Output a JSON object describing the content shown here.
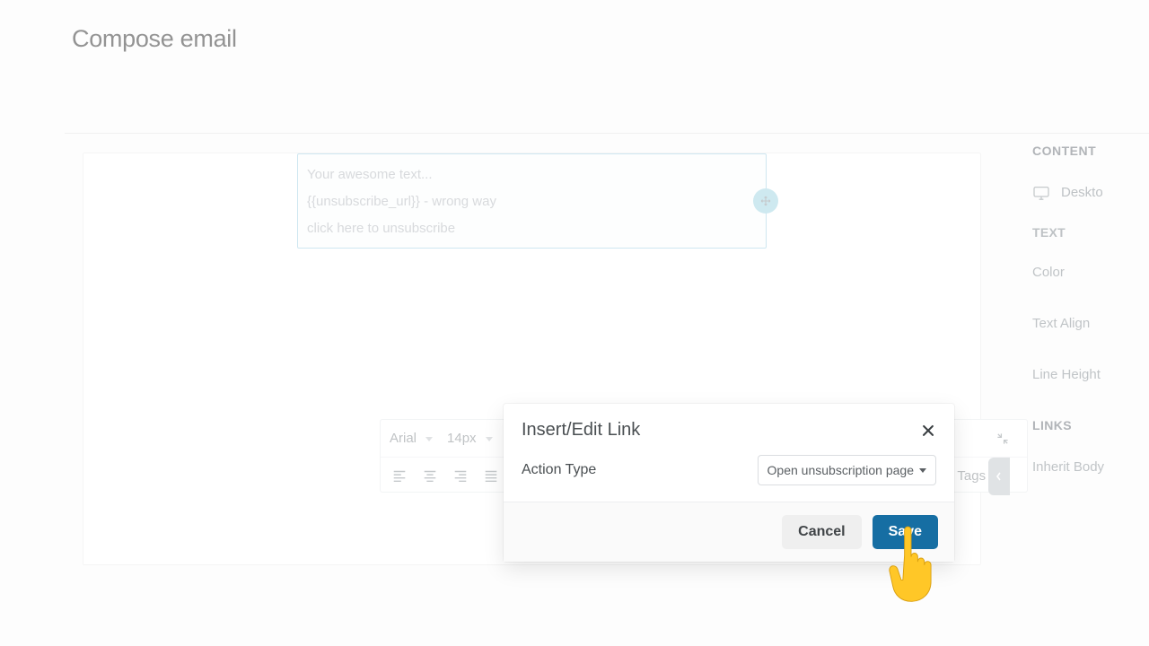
{
  "page": {
    "title": "Compose email"
  },
  "editor": {
    "lines": [
      "Your awesome text...",
      "{{unsubscribe_url}} - wrong way",
      "click here to unsubscribe"
    ],
    "font": "Arial",
    "size": "14px",
    "merge_tags_label": "Merge Tags"
  },
  "sidebar": {
    "content_label": "CONTENT",
    "desktop_label": "Deskto",
    "text_label": "TEXT",
    "options": [
      "Color",
      "Text Align",
      "Line Height"
    ],
    "links_label": "LINKS",
    "inherit_label": "Inherit Body"
  },
  "modal": {
    "title": "Insert/Edit Link",
    "field_label": "Action Type",
    "selected_option": "Open unsubscription page",
    "cancel": "Cancel",
    "save": "Save"
  }
}
